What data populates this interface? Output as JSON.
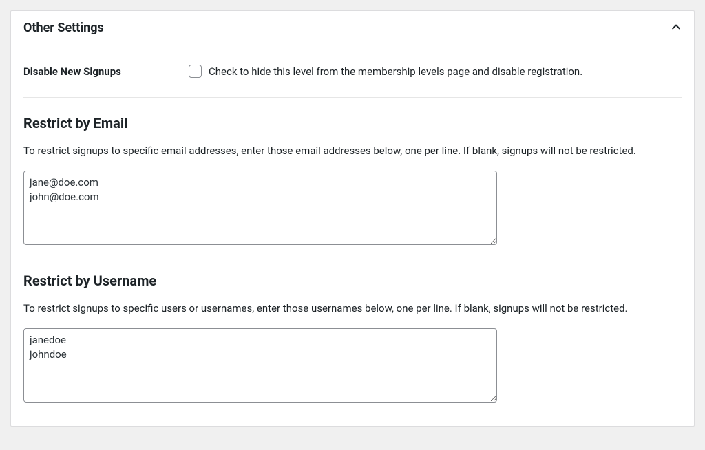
{
  "panel": {
    "title": "Other Settings"
  },
  "disableSignups": {
    "label": "Disable New Signups",
    "description": "Check to hide this level from the membership levels page and disable registration."
  },
  "restrictEmail": {
    "heading": "Restrict by Email",
    "description": "To restrict signups to specific email addresses, enter those email addresses below, one per line. If blank, signups will not be restricted.",
    "value": "jane@doe.com\njohn@doe.com"
  },
  "restrictUsername": {
    "heading": "Restrict by Username",
    "description": "To restrict signups to specific users or usernames, enter those usernames below, one per line. If blank, signups will not be restricted.",
    "value": "janedoe\njohndoe"
  }
}
